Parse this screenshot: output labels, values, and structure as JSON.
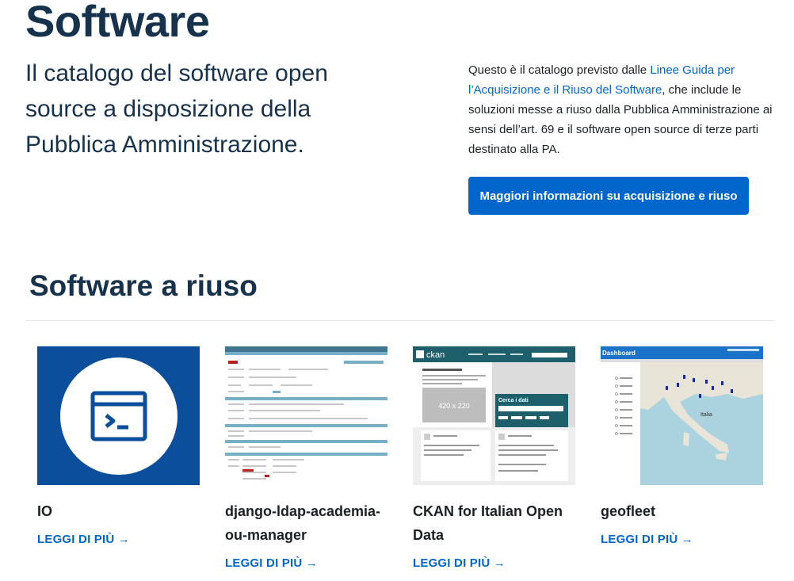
{
  "header": {
    "title": "Software",
    "subtitle": "Il catalogo del software open source a disposizione della Pubblica Amministrazione.",
    "intro_prefix": "Questo è il catalogo previsto dalle ",
    "intro_link": "Linee Guida per l’Acquisizione e il Riuso del Software",
    "intro_suffix": ", che include le soluzioni messe a riuso dalla Pubblica Amministrazione ai sensi dell’art. 69 e il software open source di terze parti destinato alla PA.",
    "cta_label": "Maggiori informazioni su acquisizione e riuso"
  },
  "section": {
    "title": "Software a riuso"
  },
  "cards": [
    {
      "title": "IO",
      "link": "LEGGI DI PIÙ →"
    },
    {
      "title": "django-ldap-academia-ou-manager",
      "link": "LEGGI DI PIÙ →"
    },
    {
      "title": "CKAN for Italian Open Data",
      "link": "LEGGI DI PIÙ →"
    },
    {
      "title": "geofleet",
      "link": "LEGGI DI PIÙ →"
    }
  ],
  "thumbnails": {
    "ckan_logo": "ckan",
    "ckan_placeholder": "420 x 220",
    "ckan_search_label": "Cerca i dati",
    "map_header": "Dashboard",
    "map_country": "Italia"
  },
  "colors": {
    "primary": "#0066cc",
    "heading": "#17324d",
    "io_blue": "#0b4f9c",
    "ckan_teal": "#1d5f6b"
  }
}
